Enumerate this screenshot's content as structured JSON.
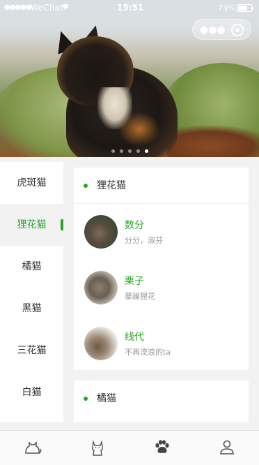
{
  "status_bar": {
    "signal": "●●●●●",
    "carrier": "WeChat",
    "time": "15:51",
    "battery": "73%"
  },
  "capsule": {
    "more_icon": "more-dots-icon",
    "close_icon": "target-close-icon"
  },
  "carousel": {
    "pages": 5,
    "active_index": 4
  },
  "categories": [
    {
      "label": "虎斑猫",
      "active": false
    },
    {
      "label": "狸花猫",
      "active": true
    },
    {
      "label": "橘猫",
      "active": false
    },
    {
      "label": "黑猫",
      "active": false
    },
    {
      "label": "三花猫",
      "active": false
    },
    {
      "label": "白猫",
      "active": false
    }
  ],
  "sections": [
    {
      "title": "狸花猫",
      "cats": [
        {
          "name": "数分",
          "desc": "分分，淑芬"
        },
        {
          "name": "栗子",
          "desc": "暴躁狸花"
        },
        {
          "name": "线代",
          "desc": "不再流浪的ta"
        }
      ]
    },
    {
      "title": "橘猫",
      "cats": []
    }
  ],
  "colors": {
    "accent": "#2aa52a",
    "text": "#333333",
    "muted": "#999999",
    "bg": "#f2f2f2"
  },
  "tabbar": [
    {
      "icon": "cat-outline-icon",
      "active": false
    },
    {
      "icon": "cat-sitting-icon",
      "active": false
    },
    {
      "icon": "paw-icon",
      "active": true
    },
    {
      "icon": "person-icon",
      "active": false
    }
  ]
}
